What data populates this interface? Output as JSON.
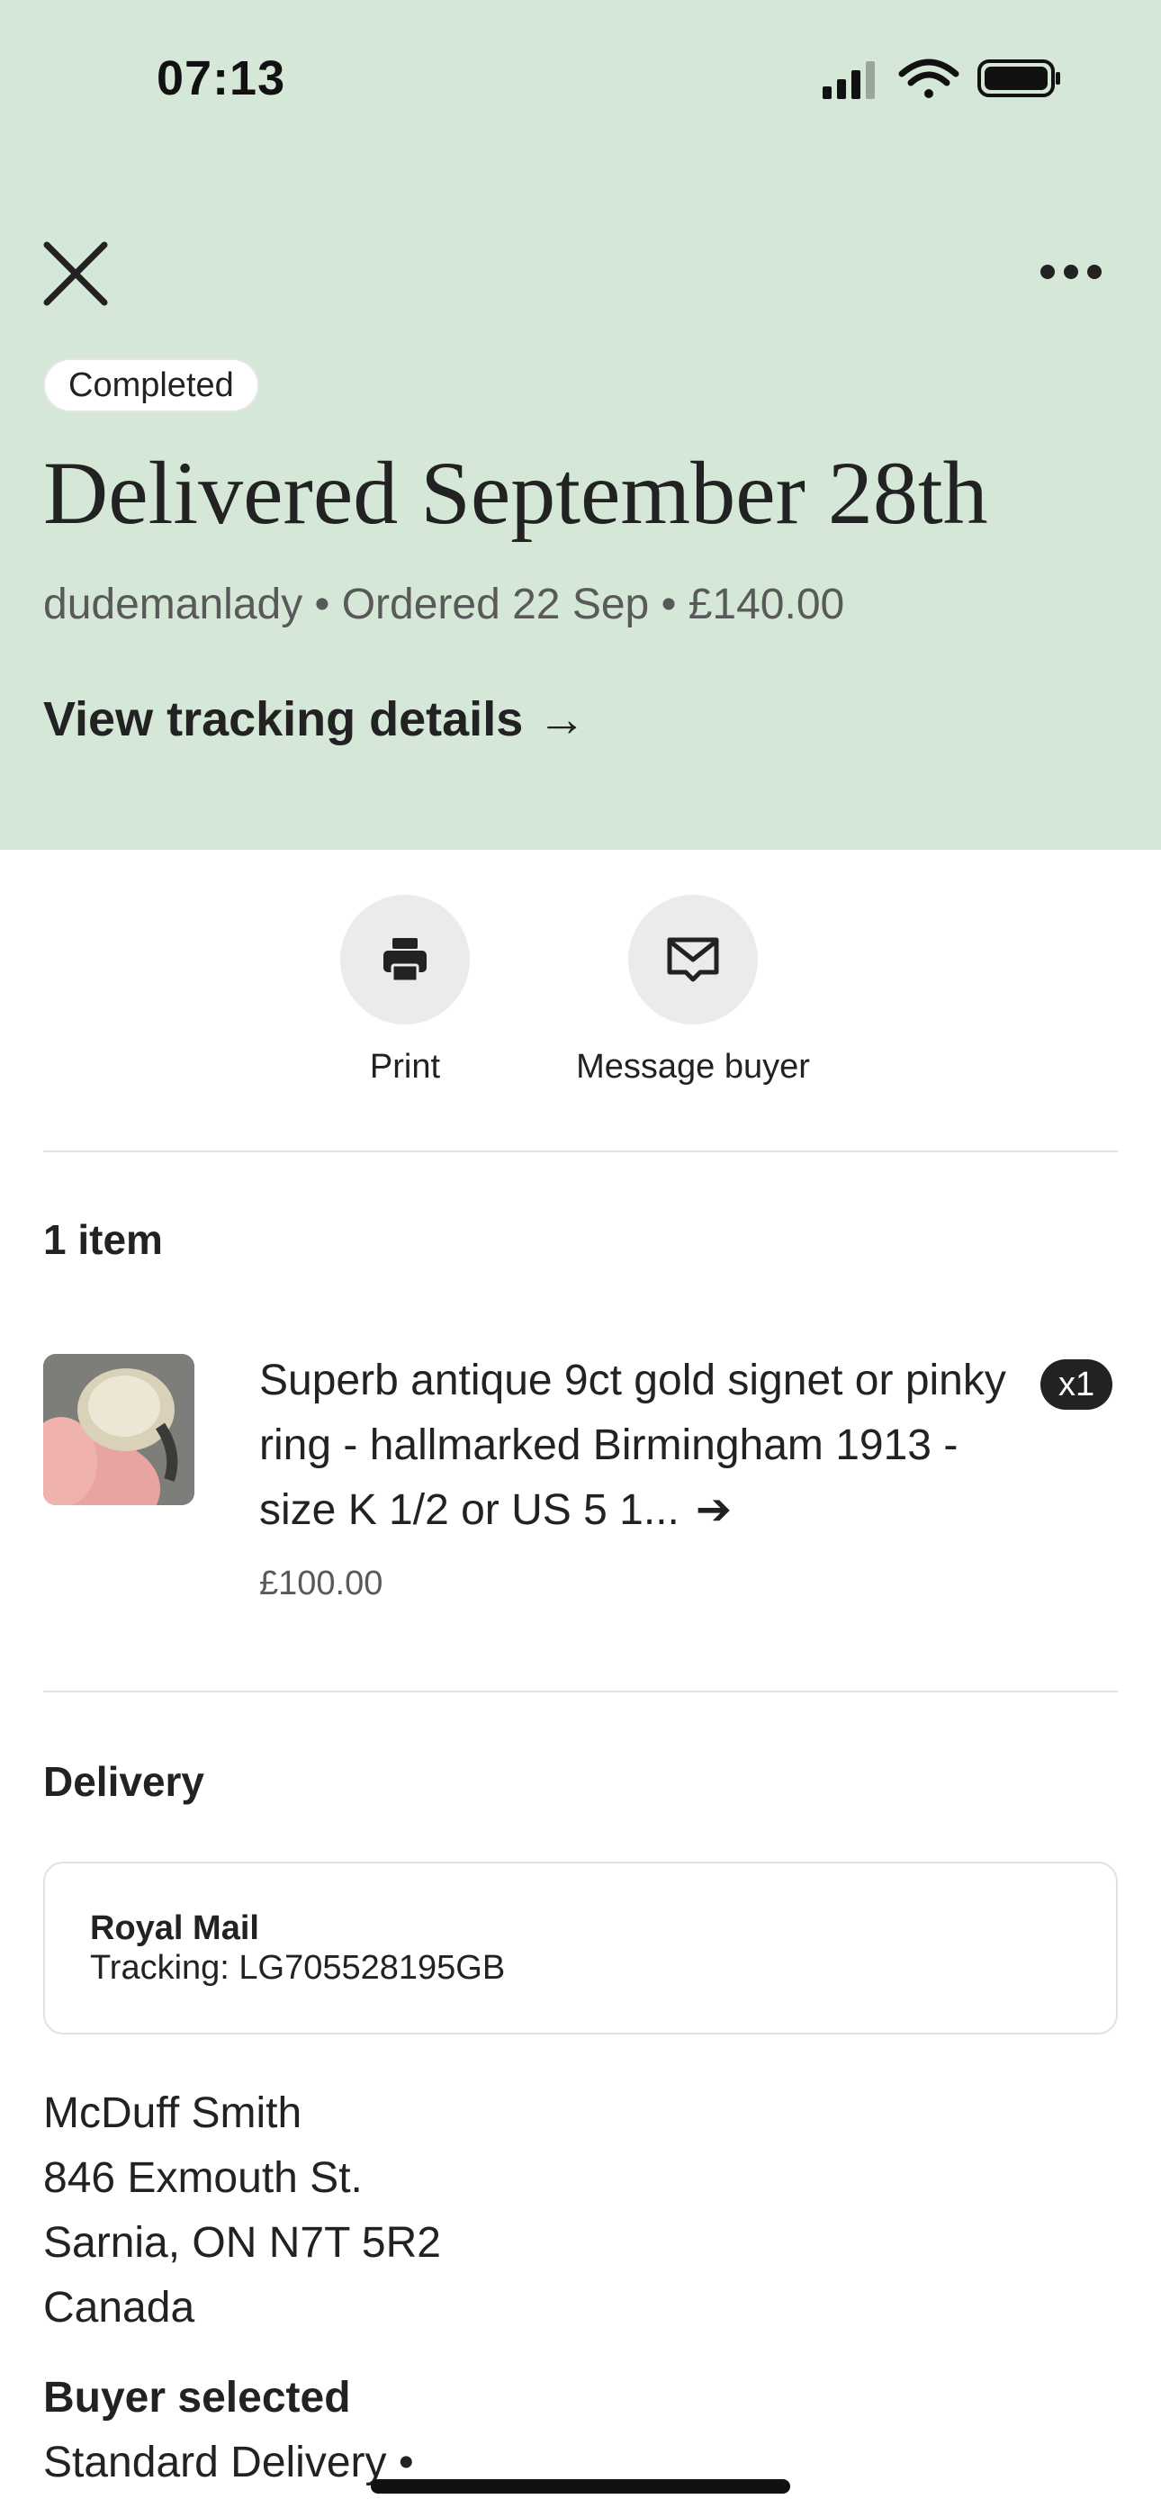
{
  "status_bar": {
    "time": "07:13"
  },
  "header": {
    "badge": "Completed",
    "title": "Delivered September 28th",
    "meta": "dudemanlady • Ordered 22 Sep • £140.00",
    "tracking_link": "View tracking details",
    "tracking_arrow": "→"
  },
  "actions": {
    "print_label": "Print",
    "message_label": "Message buyer"
  },
  "items_section": {
    "title": "1 item",
    "item": {
      "title": "Superb antique 9ct gold signet or pinky ring - hallmarked Birmingham 1913 - size K 1/2 or US 5 1...",
      "arrow": "➔",
      "quantity": "x1",
      "price": "£100.00"
    }
  },
  "delivery": {
    "title": "Delivery",
    "carrier": "Royal Mail",
    "tracking": "Tracking: LG705528195GB",
    "address": {
      "name": "McDuff Smith",
      "street": "846 Exmouth St.",
      "city": "Sarnia, ON N7T 5R2",
      "country": "Canada"
    },
    "buyer_selected_label": "Buyer selected",
    "shipping_method": "Standard Delivery  •"
  },
  "colors": {
    "header_bg": "#d5e8d8",
    "text": "#222222",
    "muted": "#595959"
  },
  "icons": [
    "signal-icon",
    "wifi-icon",
    "battery-icon",
    "close-icon",
    "more-icon",
    "printer-icon",
    "mail-icon"
  ]
}
